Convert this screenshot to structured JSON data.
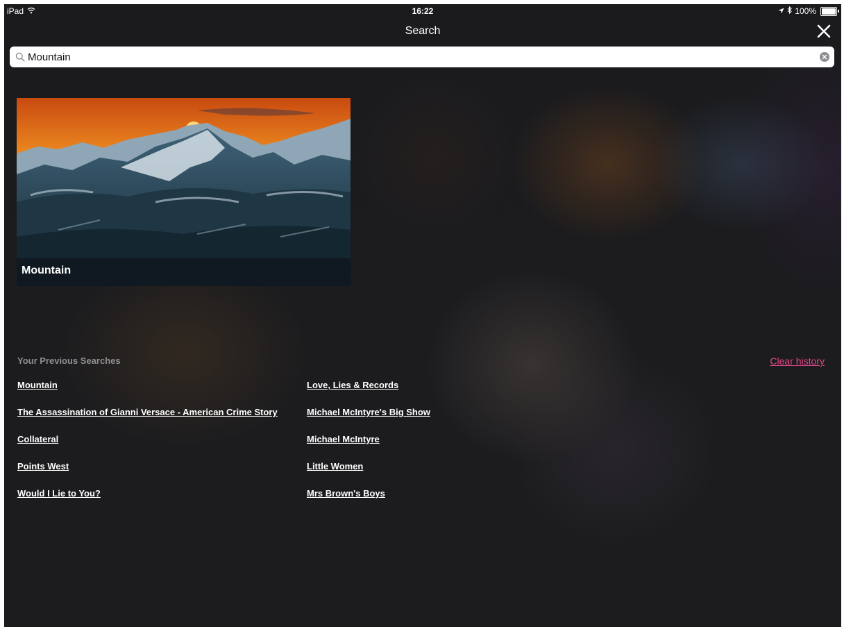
{
  "status_bar": {
    "device": "iPad",
    "time": "16:22",
    "battery_percent": "100%"
  },
  "nav": {
    "title": "Search",
    "close_icon": "close-x-icon"
  },
  "search": {
    "value": "Mountain",
    "icon": "magnifier-icon"
  },
  "results": [
    {
      "title": "Mountain"
    }
  ],
  "previous_searches": {
    "heading": "Your Previous Searches",
    "clear_label": "Clear history",
    "left_column": [
      "Mountain",
      "The Assassination of Gianni Versace - American Crime Story",
      "Collateral",
      "Points West",
      "Would I Lie to You?"
    ],
    "right_column": [
      "Love, Lies & Records",
      "Michael McIntyre's Big Show",
      "Michael McIntyre",
      "Little Women",
      "Mrs Brown's Boys"
    ]
  },
  "colors": {
    "background": "#1c1c1f",
    "accent_link": "#e6468b",
    "muted_heading": "#8f8f93"
  }
}
